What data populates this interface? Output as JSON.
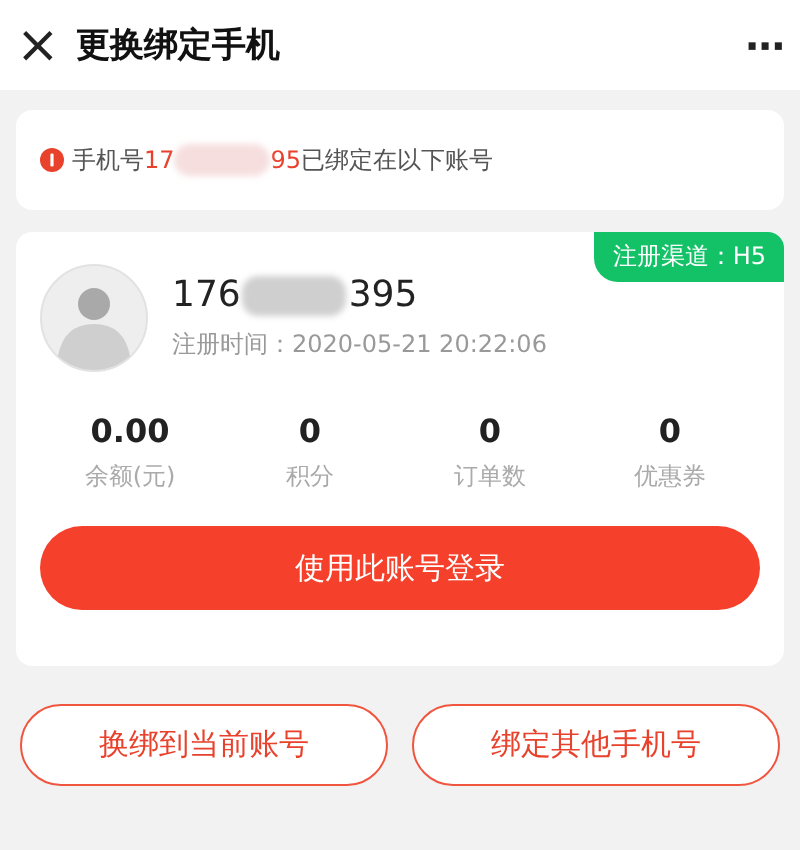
{
  "header": {
    "close_icon": "×",
    "title": "更换绑定手机",
    "more": "···"
  },
  "notice": {
    "prefix": "手机号",
    "phone_start": "17",
    "phone_end": "95",
    "suffix": "已绑定在以下账号"
  },
  "account": {
    "channel_badge": "注册渠道：H5",
    "phone_start": "176",
    "phone_end": "395",
    "registered": "注册时间：2020-05-21 20:22:06",
    "stats": [
      {
        "value": "0.00",
        "label": "余额(元)"
      },
      {
        "value": "0",
        "label": "积分"
      },
      {
        "value": "0",
        "label": "订单数"
      },
      {
        "value": "0",
        "label": "优惠券"
      }
    ],
    "login_button": "使用此账号登录"
  },
  "actions": [
    "换绑到当前账号",
    "绑定其他手机号"
  ]
}
